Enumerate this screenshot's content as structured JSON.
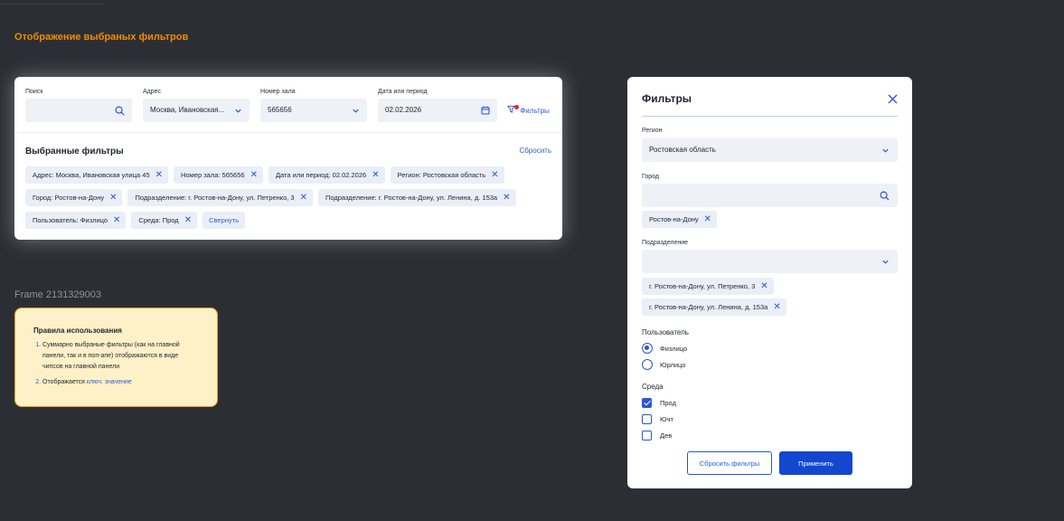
{
  "page_title": "Отображение выбраных фильтров",
  "main": {
    "search_label": "Поиск",
    "address_label": "Адрес",
    "address_value": "Москва, Ивановская...",
    "hall_label": "Номер зала",
    "hall_value": "565656",
    "date_label": "Дата или период",
    "date_value": "02.02.2026",
    "filters_link": "Фильтры",
    "selected_title": "Выбранные фильтры",
    "reset_link": "Сбросить",
    "chips": [
      "Адрес: Москва, Ивановская улица 45",
      "Номер зала: 565656",
      "Дата или период: 02.02.2026",
      "Регион: Ростовская область",
      "Город: Ростов-на-Дону",
      "Подразделение: г. Ростов-на-Дону, ул. Петренко, 3",
      "Подразделение: г. Ростов-на-Дону, ул. Ленина, д. 153а",
      "Пользователь: Физлицо",
      "Среда: Прод"
    ],
    "collapse_link": "Свернуть"
  },
  "frame_label": "Frame 2131329003",
  "rules": {
    "title": "Правила использования",
    "item1": "Суммарно выбраные фильтры (как на главной панели, так и в поп-апе) отображаются в виде чипсов на главной панели",
    "item2_prefix": "Отображается ",
    "item2_link": "ключ: значение"
  },
  "modal": {
    "title": "Фильтры",
    "region_label": "Регион",
    "region_value": "Ростовская область",
    "city_label": "Город",
    "city_chip": "Ростов-на-Дону",
    "division_label": "Подразделение",
    "division_chips": [
      "г. Ростов-на-Дону, ул. Петренко, 3",
      "г. Ростов-на-Дону, ул. Ленина, д. 153а"
    ],
    "user_label": "Пользователь",
    "user_options": [
      "Физлицо",
      "Юрлицо"
    ],
    "env_label": "Среда",
    "env_options": [
      "Прод",
      "Ючт",
      "Дев"
    ],
    "reset_button": "Сбросить фильтры",
    "apply_button": "Применить"
  },
  "icons": {
    "search": "search-icon",
    "chevron": "chevron-down-icon",
    "calendar": "calendar-icon",
    "filter": "filter-icon",
    "close": "close-icon"
  },
  "colors": {
    "background": "#2b2f35",
    "accent": "#2955d8",
    "title_orange": "#f08c00",
    "primary_button": "#1347d0",
    "note_bg": "#fff1c7"
  }
}
